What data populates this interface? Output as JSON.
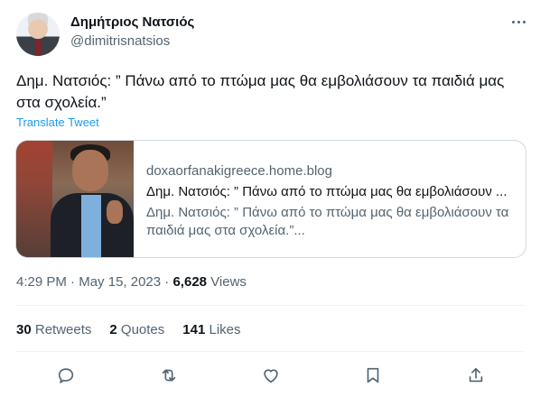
{
  "author": {
    "name": "Δημήτριος Νατσιός",
    "handle": "@dimitrisnatsios"
  },
  "tweet": {
    "text": "Δημ. Νατσιός: ” Πάνω από το πτώμα μας θα εμβολιάσουν τα παιδιά μας στα σχολεία.”",
    "translate_label": "Translate Tweet"
  },
  "card": {
    "domain": "doxaorfanakigreece.home.blog",
    "title": "Δημ. Νατσιός: ” Πάνω από το πτώμα μας θα εμβολιάσουν ...",
    "description": "Δημ. Νατσιός: ” Πάνω από το πτώμα μας θα εμβολιάσουν τα παιδιά μας στα σχολεία.”..."
  },
  "meta": {
    "time": "4:29 PM",
    "separator": "·",
    "date": "May 15, 2023",
    "views_count": "6,628",
    "views_label": "Views"
  },
  "stats": {
    "retweets_count": "30",
    "retweets_label": "Retweets",
    "quotes_count": "2",
    "quotes_label": "Quotes",
    "likes_count": "141",
    "likes_label": "Likes"
  },
  "actions": [
    "reply-icon",
    "retweet-icon",
    "like-icon",
    "bookmark-icon",
    "share-icon"
  ],
  "colors": {
    "link": "#1d9bf0",
    "secondary_text": "#536471",
    "primary_text": "#0f1419",
    "border": "#cfd9de"
  }
}
